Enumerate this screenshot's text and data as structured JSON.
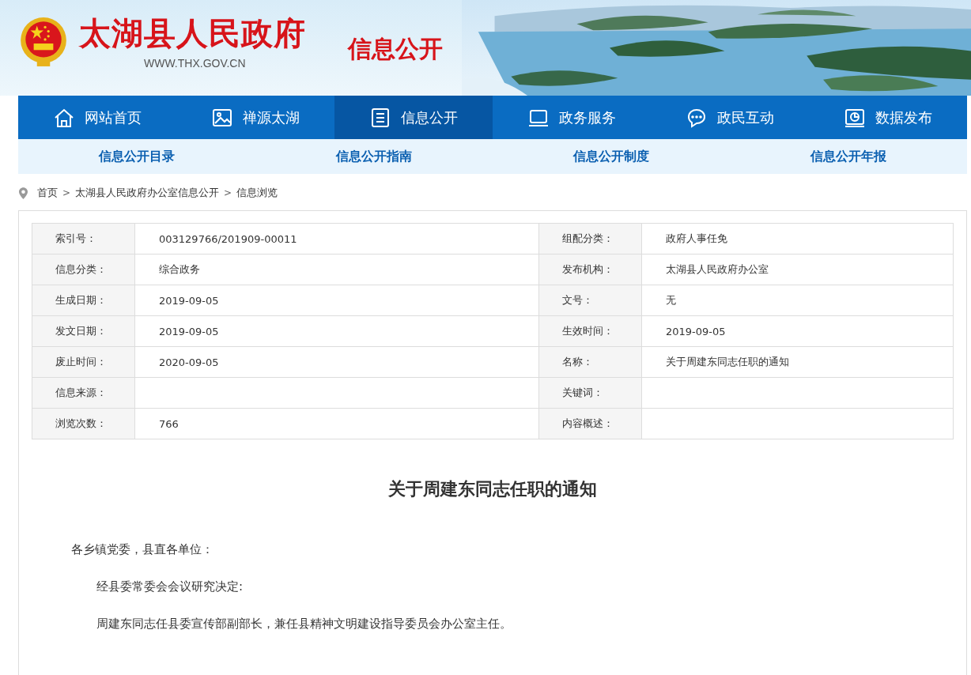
{
  "header": {
    "site_name": "太湖县人民政府",
    "site_url": "WWW.THX.GOV.CN",
    "section_title": "信息公开"
  },
  "nav": [
    {
      "label": "网站首页",
      "selected": false
    },
    {
      "label": "禅源太湖",
      "selected": false
    },
    {
      "label": "信息公开",
      "selected": true
    },
    {
      "label": "政务服务",
      "selected": false
    },
    {
      "label": "政民互动",
      "selected": false
    },
    {
      "label": "数据发布",
      "selected": false
    }
  ],
  "subnav": [
    "信息公开目录",
    "信息公开指南",
    "信息公开制度",
    "信息公开年报"
  ],
  "breadcrumb": [
    {
      "kind": "link",
      "text": "首页"
    },
    {
      "kind": "sep",
      "text": ">"
    },
    {
      "kind": "link",
      "text": "太湖县人民政府办公室信息公开"
    },
    {
      "kind": "sep",
      "text": ">"
    },
    {
      "kind": "link",
      "text": "信息浏览"
    }
  ],
  "info_table": [
    [
      {
        "label": "索引号：",
        "value": "003129766/201909-00011"
      },
      {
        "label": "组配分类：",
        "value": "政府人事任免"
      }
    ],
    [
      {
        "label": "信息分类：",
        "value": "综合政务"
      },
      {
        "label": "发布机构：",
        "value": "太湖县人民政府办公室"
      }
    ],
    [
      {
        "label": "生成日期：",
        "value": "2019-09-05"
      },
      {
        "label": "文号：",
        "value": "无"
      }
    ],
    [
      {
        "label": "发文日期：",
        "value": "2019-09-05"
      },
      {
        "label": "生效时间：",
        "value": "2019-09-05"
      }
    ],
    [
      {
        "label": "废止时间：",
        "value": "2020-09-05"
      },
      {
        "label": "名称：",
        "value": "关于周建东同志任职的通知"
      }
    ],
    [
      {
        "label": "信息来源："
      },
      {
        "label": "关键词："
      }
    ],
    [
      {
        "label": "浏览次数：",
        "value": "766"
      },
      {
        "label": "内容概述："
      }
    ]
  ],
  "article": {
    "title": "关于周建东同志任职的通知",
    "paragraphs": [
      {
        "kind": "salutation",
        "text": "各乡镇党委，县直各单位："
      },
      {
        "kind": "body",
        "text": "经县委常委会会议研究决定:"
      },
      {
        "kind": "body",
        "text": "周建东同志任县委宣传部副部长，兼任县精神文明建设指导委员会办公室主任。"
      }
    ]
  }
}
